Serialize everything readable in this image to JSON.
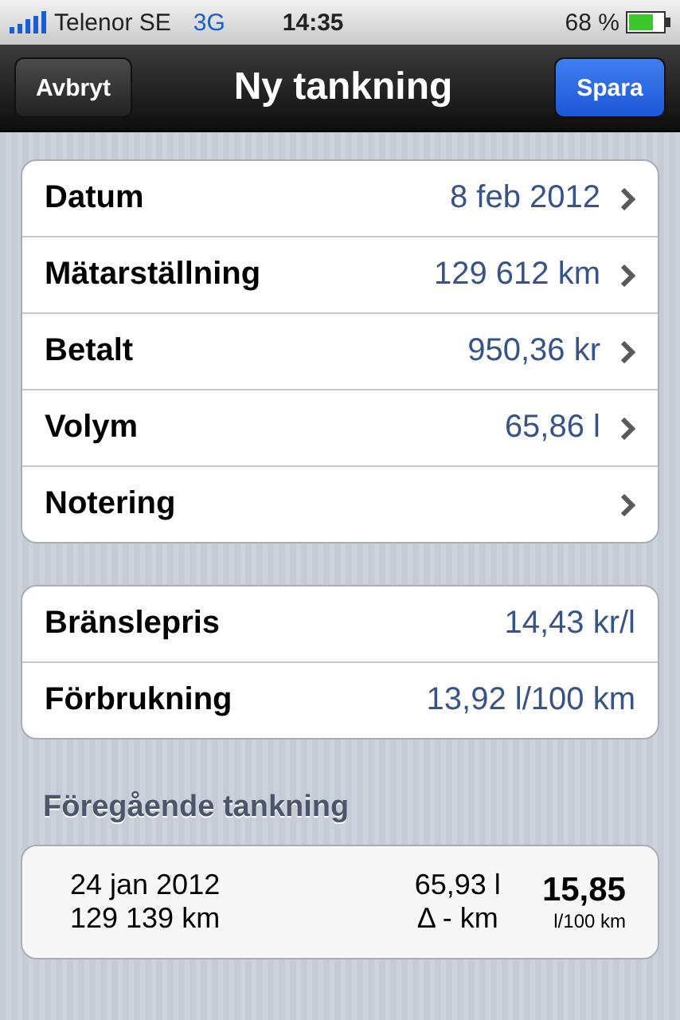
{
  "status_bar": {
    "carrier": "Telenor SE",
    "network": "3G",
    "time": "14:35",
    "battery": "68 %"
  },
  "nav_bar": {
    "cancel": "Avbryt",
    "title": "Ny tankning",
    "save": "Spara"
  },
  "groups": [
    {
      "rows": [
        {
          "label": "Datum",
          "value": "8 feb 2012",
          "kind": "link"
        },
        {
          "label": "Mätarställning",
          "value": "129 612 km",
          "kind": "link"
        },
        {
          "label": "Betalt",
          "value": "950,36 kr",
          "kind": "link"
        },
        {
          "label": "Volym",
          "value": "65,86 l",
          "kind": "link"
        },
        {
          "label": "Notering",
          "kind": "link"
        }
      ]
    },
    {
      "rows": [
        {
          "label": "Bränslepris",
          "value": "14,43 kr/l",
          "kind": "readonly"
        },
        {
          "label": "Förbrukning",
          "value": "13,92 l/100 km",
          "kind": "readonly"
        }
      ]
    }
  ],
  "previous": {
    "header": "Föregående tankning",
    "date": "24 jan 2012",
    "odometer": "129 139 km",
    "volume": "65,93 l",
    "distance": "Δ - km",
    "consumption": "15,85",
    "unit": "l/100 km"
  }
}
